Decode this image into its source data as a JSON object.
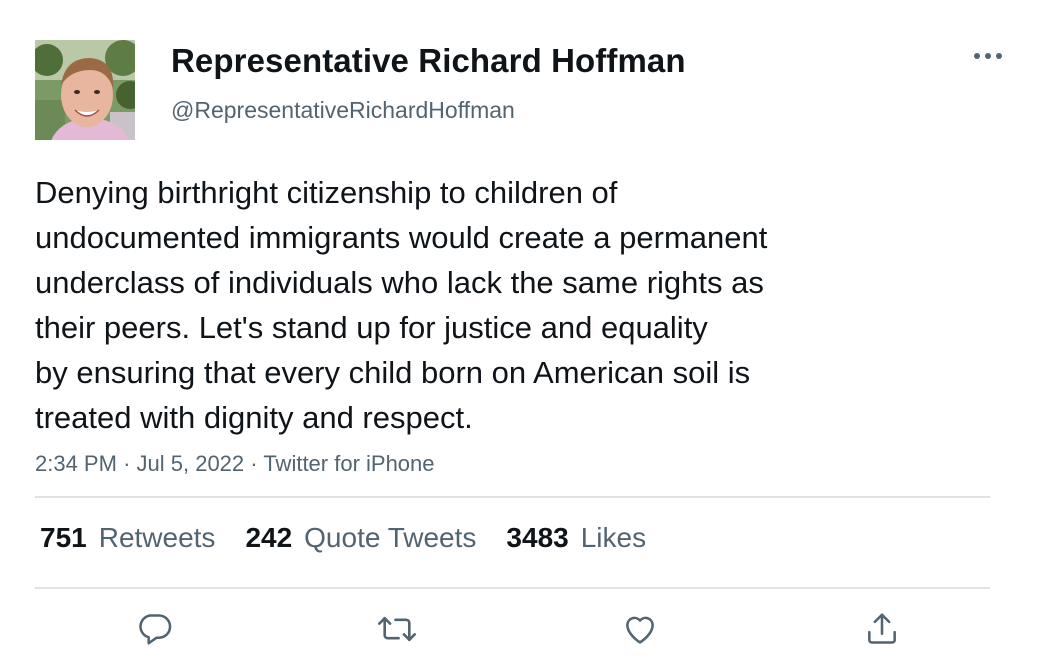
{
  "author": {
    "display_name": "Representative Richard Hoffman",
    "handle": "@RepresentativeRichardHoffman",
    "avatar_icon": "profile-photo"
  },
  "tweet": {
    "lines": [
      "Denying birthright citizenship to children of",
      "undocumented immigrants would create a permanent",
      "underclass of individuals who lack the same rights as",
      "their peers. Let's stand up for justice and equality",
      "by ensuring that every child born on American soil is",
      "treated with dignity and respect."
    ],
    "time": "2:34 PM",
    "date": "Jul 5, 2022",
    "source": "Twitter for iPhone",
    "separator": "·"
  },
  "stats": {
    "retweets_count": "751",
    "retweets_label": "Retweets",
    "quotes_count": "242",
    "quotes_label": "Quote Tweets",
    "likes_count": "3483",
    "likes_label": "Likes"
  },
  "actions": [
    {
      "name": "reply",
      "icon": "reply-icon"
    },
    {
      "name": "retweet",
      "icon": "retweet-icon"
    },
    {
      "name": "like",
      "icon": "heart-icon"
    },
    {
      "name": "share",
      "icon": "share-icon"
    }
  ],
  "colors": {
    "text_primary": "#0f1419",
    "text_secondary": "#536471",
    "divider": "#dfe3e6",
    "icon": "#536471"
  }
}
